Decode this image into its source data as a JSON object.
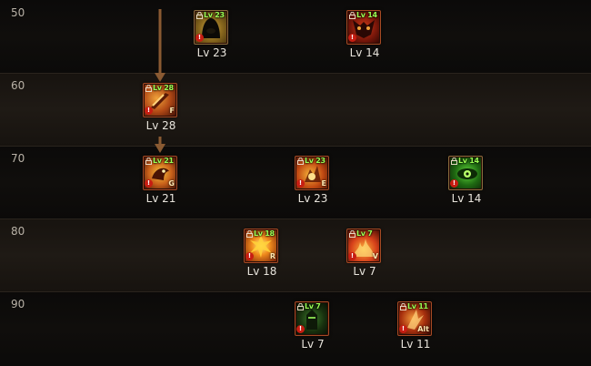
{
  "levels": [
    "50",
    "60",
    "70",
    "80",
    "90"
  ],
  "skills": [
    {
      "id": "s50a",
      "lv_label": "Lv 23",
      "badge": "Lv 23",
      "hotkey": "",
      "icon": "dark-hood-icon"
    },
    {
      "id": "s50b",
      "lv_label": "Lv 14",
      "badge": "Lv 14",
      "hotkey": "",
      "icon": "demon-mask-icon"
    },
    {
      "id": "s60a",
      "lv_label": "Lv 28",
      "badge": "Lv 28",
      "hotkey": "F",
      "icon": "fire-sword-icon"
    },
    {
      "id": "s70a",
      "lv_label": "Lv 21",
      "badge": "Lv 21",
      "hotkey": "G",
      "icon": "flame-beast-icon"
    },
    {
      "id": "s70b",
      "lv_label": "Lv 23",
      "badge": "Lv 23",
      "hotkey": "E",
      "icon": "fire-burst-icon"
    },
    {
      "id": "s70c",
      "lv_label": "Lv 14",
      "badge": "Lv 14",
      "hotkey": "",
      "icon": "green-eye-icon"
    },
    {
      "id": "s80a",
      "lv_label": "Lv 18",
      "badge": "Lv 18",
      "hotkey": "R",
      "icon": "explosion-icon"
    },
    {
      "id": "s80b",
      "lv_label": "Lv 7",
      "badge": "Lv 7",
      "hotkey": "V",
      "icon": "fire-wave-icon"
    },
    {
      "id": "s90a",
      "lv_label": "Lv 7",
      "badge": "Lv 7",
      "hotkey": "",
      "icon": "armored-knight-icon"
    },
    {
      "id": "s90b",
      "lv_label": "Lv 11",
      "badge": "Lv 11",
      "hotkey": "Alt",
      "icon": "flame-strike-icon"
    }
  ],
  "colors": {
    "accent_green": "#9bff53",
    "frame": "#a64a24",
    "arrow": "#8a5a32"
  }
}
